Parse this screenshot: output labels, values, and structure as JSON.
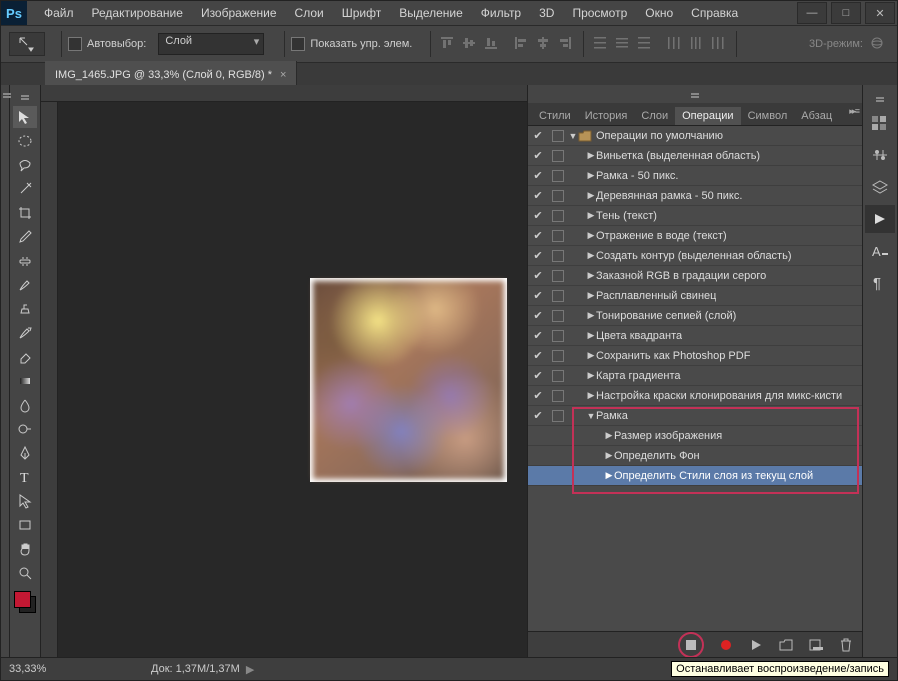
{
  "app_logo": "Ps",
  "menu": [
    "Файл",
    "Редактирование",
    "Изображение",
    "Слои",
    "Шрифт",
    "Выделение",
    "Фильтр",
    "3D",
    "Просмотр",
    "Окно",
    "Справка"
  ],
  "window_controls": {
    "min": "—",
    "max": "□",
    "close": "✕"
  },
  "options": {
    "autoselect_label": "Автовыбор:",
    "autoselect_value": "Слой",
    "show_transform": "Показать упр. элем.",
    "mode3d": "3D-режим:"
  },
  "doc_tab": "IMG_1465.JPG @ 33,3% (Слой 0, RGB/8) *",
  "panel_tabs": [
    "Стили",
    "История",
    "Слои",
    "Операции",
    "Символ",
    "Абзац"
  ],
  "panel_active": 3,
  "actions": {
    "set": {
      "label": "Операции по умолчанию"
    },
    "items": [
      {
        "label": "Виньетка (выделенная область)"
      },
      {
        "label": "Рамка - 50 пикс."
      },
      {
        "label": "Деревянная рамка - 50 пикс."
      },
      {
        "label": "Тень (текст)"
      },
      {
        "label": "Отражение в воде (текст)"
      },
      {
        "label": "Создать контур (выделенная область)"
      },
      {
        "label": "Заказной RGB в градации серого"
      },
      {
        "label": "Расплавленный свинец"
      },
      {
        "label": "Тонирование сепией (слой)"
      },
      {
        "label": "Цвета квадранта"
      },
      {
        "label": "Сохранить как Photoshop PDF"
      },
      {
        "label": "Карта градиента"
      },
      {
        "label": "Настройка краски клонирования для микс-кисти"
      }
    ],
    "open_action": {
      "label": "Рамка"
    },
    "steps": [
      {
        "label": "Размер изображения"
      },
      {
        "label": "Определить Фон"
      },
      {
        "label": "Определить Стили слоя из текущ слой",
        "selected": true
      }
    ]
  },
  "status": {
    "zoom": "33,33%",
    "docinfo": "Док: 1,37M/1,37M"
  },
  "tooltip": "Останавливает воспроизведение/запись"
}
